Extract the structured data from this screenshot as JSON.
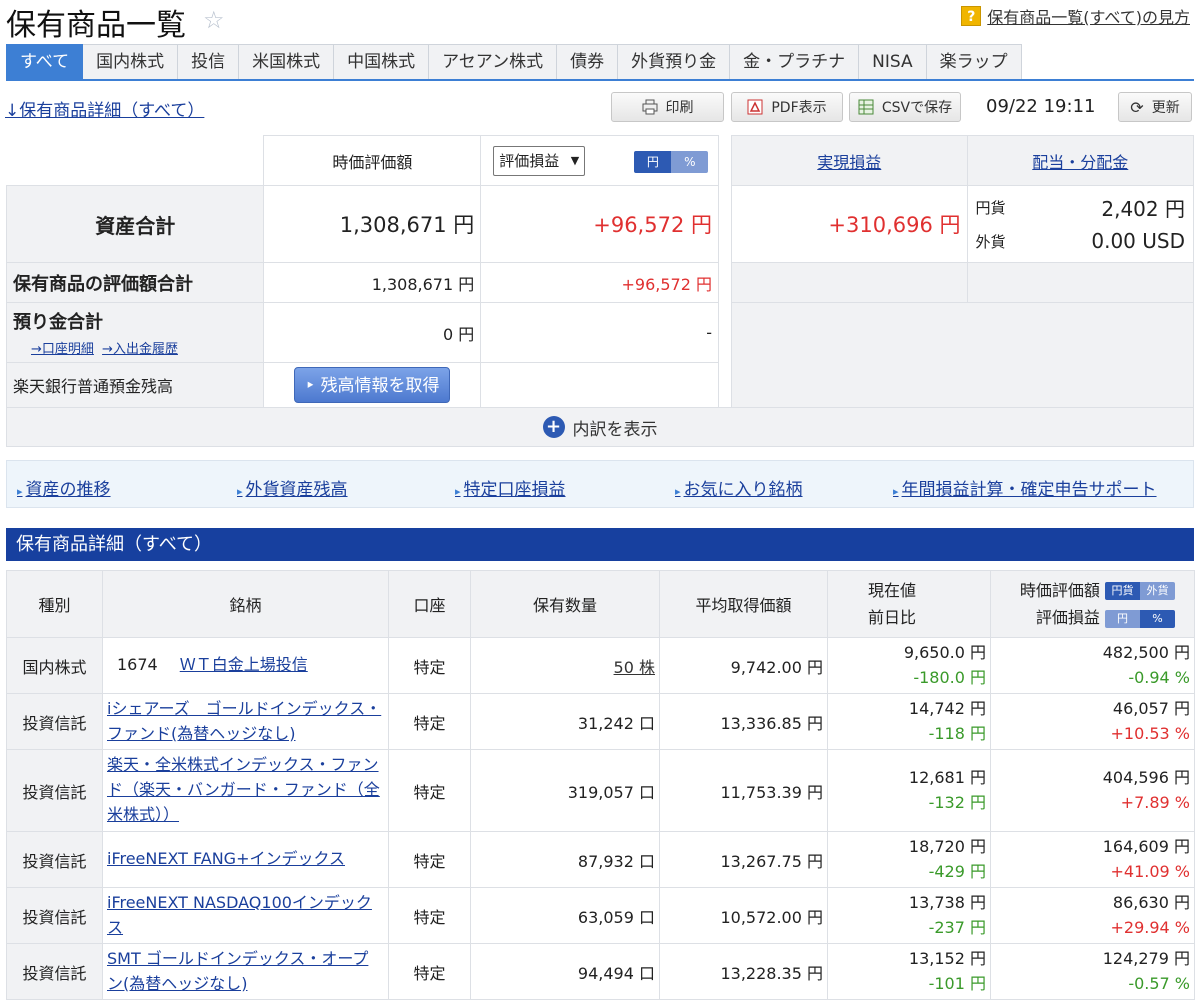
{
  "header": {
    "title": "保有商品一覧",
    "help_badge": "?",
    "help_link": "保有商品一覧(すべて)の見方"
  },
  "tabs": [
    "すべて",
    "国内株式",
    "投信",
    "米国株式",
    "中国株式",
    "アセアン株式",
    "債券",
    "外貨預り金",
    "金・プラチナ",
    "NISA",
    "楽ラップ"
  ],
  "toolbar": {
    "detail_link": "↓保有商品詳細（すべて）",
    "print": "印刷",
    "pdf": "PDF表示",
    "csv": "CSVで保存",
    "datetime": "09/22 19:11",
    "refresh": "更新"
  },
  "summary": {
    "col_market_value": "時価評価額",
    "select_value": "評価損益",
    "toggle_yen": "円",
    "toggle_pct": "%",
    "col_realized": "実現損益",
    "col_dividend": "配当・分配金",
    "total_label": "資産合計",
    "total_value": "1,308,671 円",
    "total_gain": "+96,572 円",
    "realized_value": "+310,696 円",
    "div_jpy_label": "円貨",
    "div_jpy_value": "2,402 円",
    "div_fx_label": "外貨",
    "div_fx_value": "0.00 USD",
    "holdings_label": "保有商品の評価額合計",
    "holdings_value": "1,308,671 円",
    "holdings_gain": "+96,572 円",
    "deposit_label": "預り金合計",
    "deposit_link1": "→口座明細",
    "deposit_link2": "→入出金履歴",
    "deposit_value": "0 円",
    "deposit_gain": "-",
    "bank_label": "楽天銀行普通預金残高",
    "bank_button": "残高情報を取得"
  },
  "breakdown": "内訳を表示",
  "links": [
    "資産の推移",
    "外貨資産残高",
    "特定口座損益",
    "お気に入り銘柄",
    "年間損益計算・確定申告サポート"
  ],
  "section_title": "保有商品詳細（すべて）",
  "holdings": {
    "headers": {
      "type": "種別",
      "name": "銘柄",
      "account": "口座",
      "qty": "保有数量",
      "avg": "平均取得価額",
      "price": "現在値",
      "change": "前日比",
      "mv": "時価評価額",
      "gain": "評価損益",
      "mv_t1": "円貨",
      "mv_t2": "外貨",
      "gain_t1": "円",
      "gain_t2": "%"
    },
    "rows": [
      {
        "type": "国内株式",
        "code": "1674",
        "name": "ＷＴ白金上場投信",
        "account": "特定",
        "qty": "50 株",
        "avg": "9,742.00 円",
        "price": "9,650.0 円",
        "change": "-180.0 円",
        "mv": "482,500 円",
        "gain": "-0.94 %",
        "gain_sign": "neg"
      },
      {
        "type": "投資信託",
        "code": "",
        "name": "iシェアーズ　ゴールドインデックス・ファンド(為替ヘッジなし)",
        "account": "特定",
        "qty": "31,242 口",
        "avg": "13,336.85 円",
        "price": "14,742 円",
        "change": "-118 円",
        "mv": "46,057 円",
        "gain": "+10.53 %",
        "gain_sign": "pos"
      },
      {
        "type": "投資信託",
        "code": "",
        "name": "楽天・全米株式インデックス・ファンド（楽天・バンガード・ファンド（全米株式））",
        "account": "特定",
        "qty": "319,057 口",
        "avg": "11,753.39 円",
        "price": "12,681 円",
        "change": "-132 円",
        "mv": "404,596 円",
        "gain": "+7.89 %",
        "gain_sign": "pos"
      },
      {
        "type": "投資信託",
        "code": "",
        "name": "iFreeNEXT FANG+インデックス",
        "account": "特定",
        "qty": "87,932 口",
        "avg": "13,267.75 円",
        "price": "18,720 円",
        "change": "-429 円",
        "mv": "164,609 円",
        "gain": "+41.09 %",
        "gain_sign": "pos"
      },
      {
        "type": "投資信託",
        "code": "",
        "name": "iFreeNEXT NASDAQ100インデックス",
        "account": "特定",
        "qty": "63,059 口",
        "avg": "10,572.00 円",
        "price": "13,738 円",
        "change": "-237 円",
        "mv": "86,630 円",
        "gain": "+29.94 %",
        "gain_sign": "pos"
      },
      {
        "type": "投資信託",
        "code": "",
        "name": "SMT ゴールドインデックス・オープン(為替ヘッジなし)",
        "account": "特定",
        "qty": "94,494 口",
        "avg": "13,228.35 円",
        "price": "13,152 円",
        "change": "-101 円",
        "mv": "124,279 円",
        "gain": "-0.57 %",
        "gain_sign": "neg"
      }
    ]
  },
  "colors": {
    "accent": "#3d7fd4",
    "section": "#17409f",
    "positive": "#e03030",
    "negative": "#3a9a2a"
  }
}
